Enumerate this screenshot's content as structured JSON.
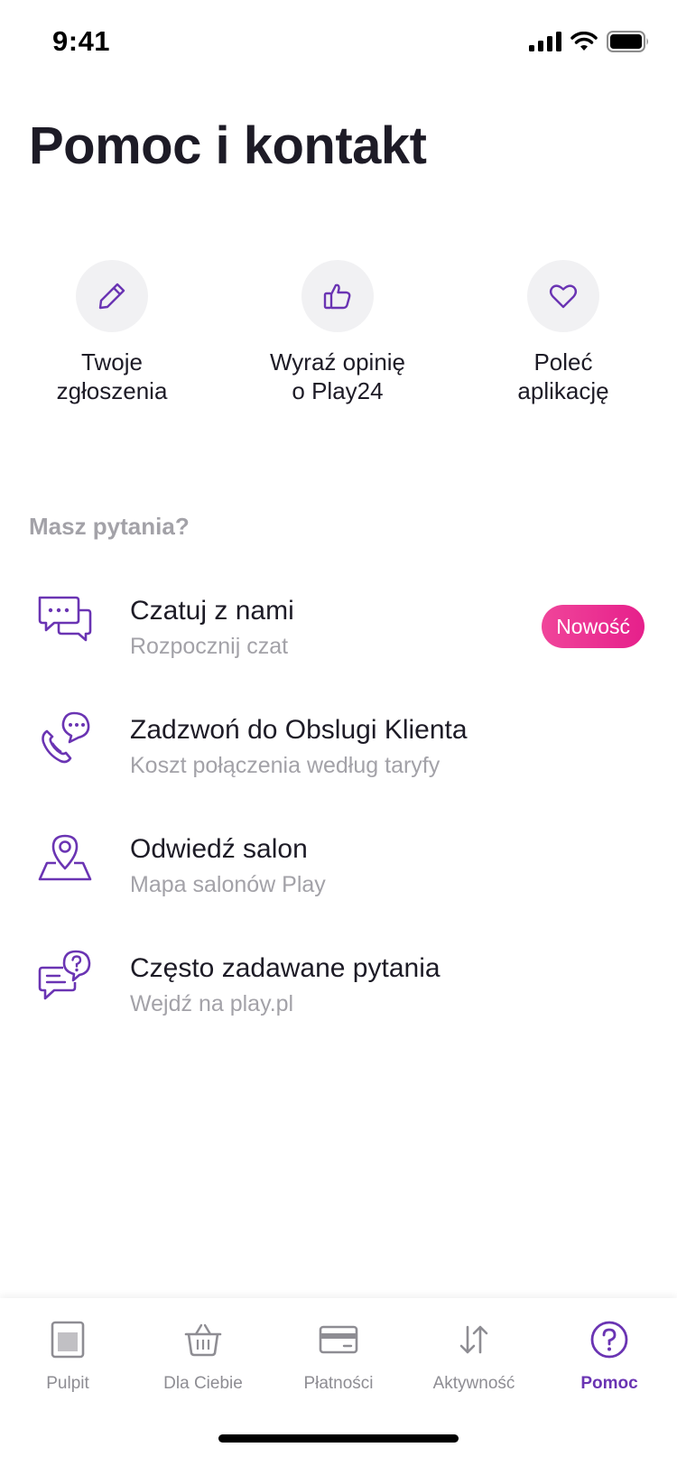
{
  "status_bar": {
    "time": "9:41"
  },
  "page": {
    "title": "Pomoc i kontakt"
  },
  "quick_actions": [
    {
      "label": "Twoje\nzgłoszenia",
      "icon": "pencil-icon"
    },
    {
      "label": "Wyraź opinię\no Play24",
      "icon": "thumbs-up-icon"
    },
    {
      "label": "Poleć\naplikację",
      "icon": "heart-icon"
    }
  ],
  "section": {
    "heading": "Masz pytania?"
  },
  "help_items": [
    {
      "title": "Czatuj z nami",
      "subtitle": "Rozpocznij czat",
      "badge": "Nowość",
      "icon": "chat-bubbles-icon"
    },
    {
      "title": "Zadzwoń do Obslugi Klienta",
      "subtitle": "Koszt połączenia według taryfy",
      "icon": "phone-chat-icon"
    },
    {
      "title": "Odwiedź salon",
      "subtitle": "Mapa salonów Play",
      "icon": "map-pin-icon"
    },
    {
      "title": "Często zadawane pytania",
      "subtitle": "Wejdź na play.pl",
      "icon": "faq-bubbles-icon"
    }
  ],
  "tab_bar": {
    "tabs": [
      {
        "label": "Pulpit",
        "icon": "dashboard-icon"
      },
      {
        "label": "Dla Ciebie",
        "icon": "basket-icon"
      },
      {
        "label": "Płatności",
        "icon": "card-icon"
      },
      {
        "label": "Aktywność",
        "icon": "arrows-updown-icon"
      },
      {
        "label": "Pomoc",
        "icon": "question-circle-icon",
        "active": true
      }
    ]
  },
  "colors": {
    "accent": "#6a34b3",
    "badge": "#e6208b",
    "muted": "#a3a2a8",
    "text": "#1d1b26"
  }
}
